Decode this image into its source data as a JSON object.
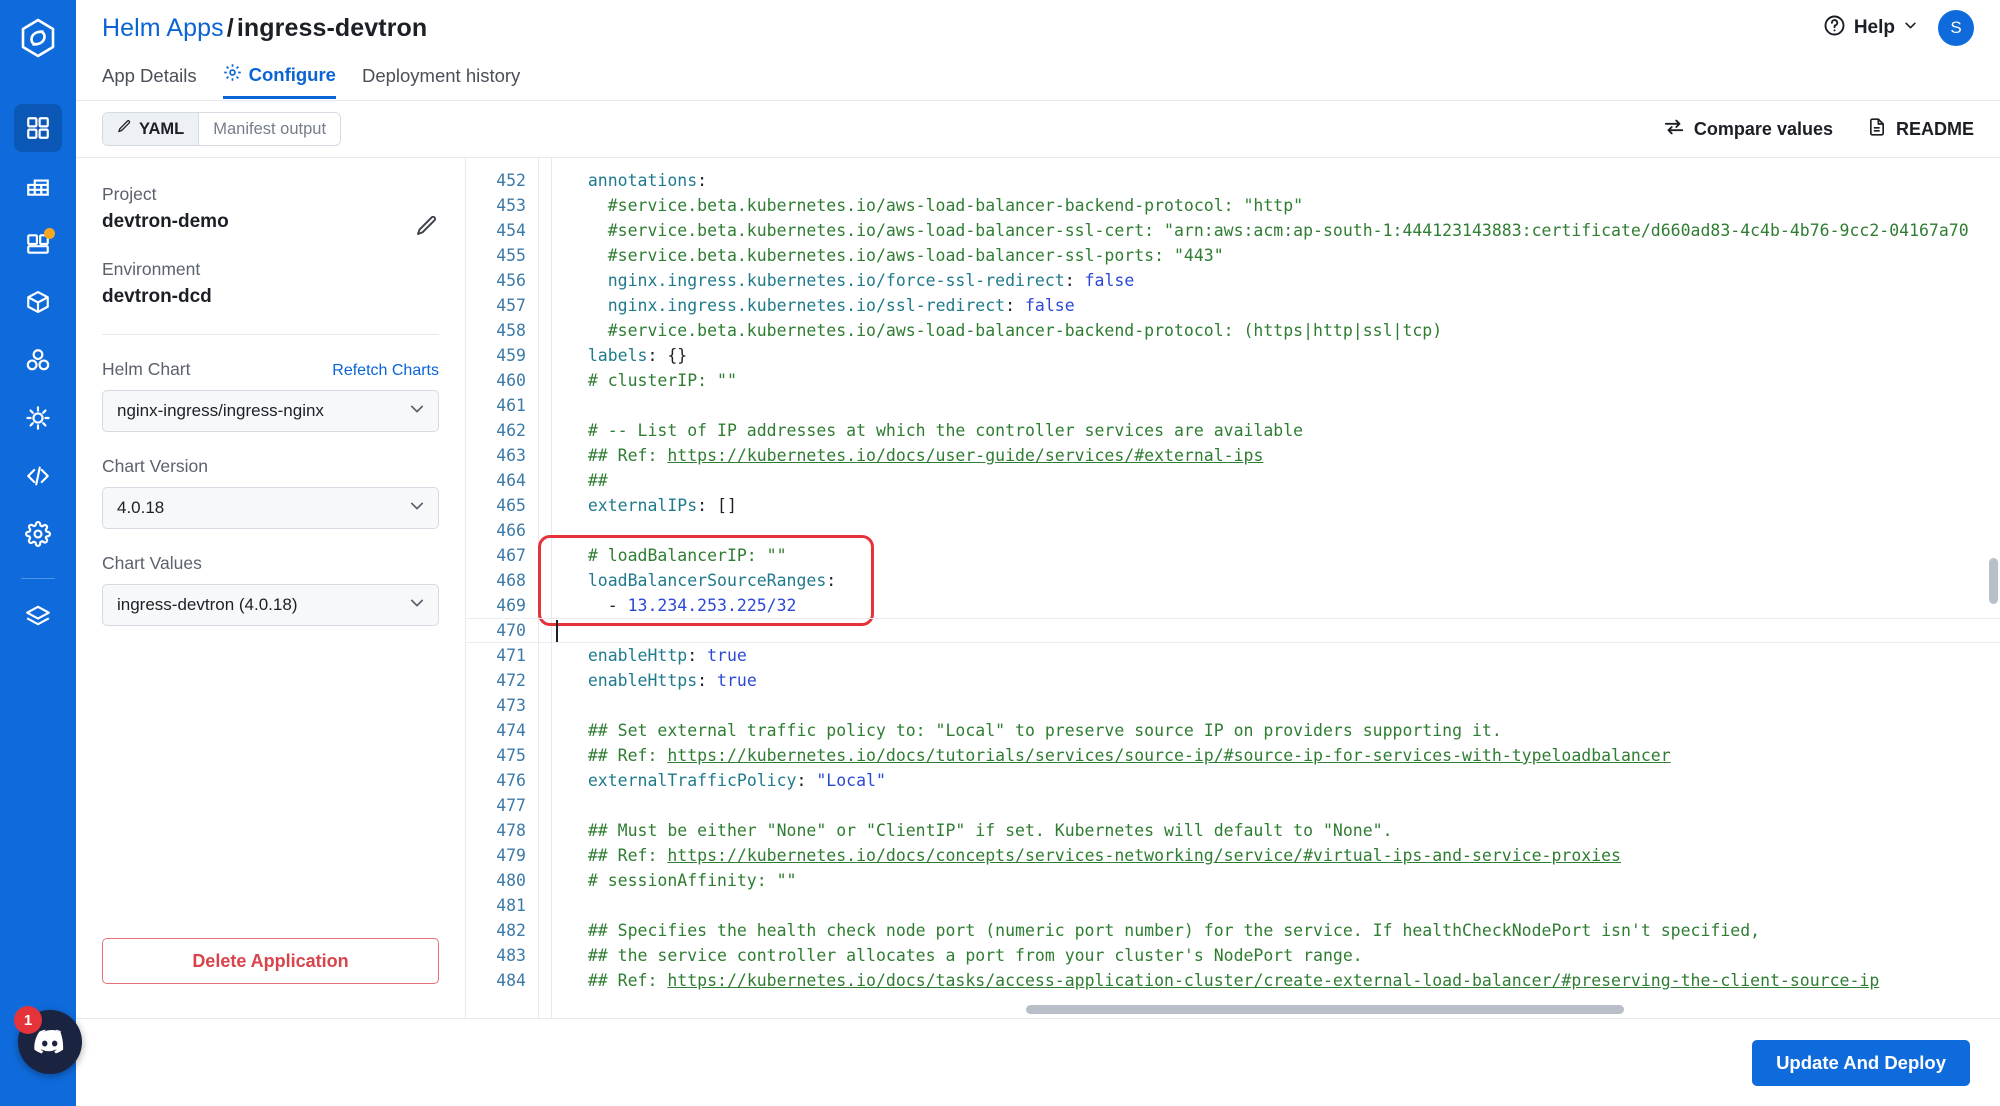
{
  "rail": {
    "logo_icon": "devtron-logo-icon",
    "items": [
      {
        "name": "applications",
        "icon": "grid-icon",
        "active": true,
        "dot": false
      },
      {
        "name": "jobs",
        "icon": "table-icon",
        "active": false,
        "dot": false
      },
      {
        "name": "charts",
        "icon": "blocks-icon",
        "active": false,
        "dot": true
      },
      {
        "name": "resource-browser",
        "icon": "cube-icon",
        "active": false,
        "dot": false
      },
      {
        "name": "clusters",
        "icon": "molecule-icon",
        "active": false,
        "dot": false
      },
      {
        "name": "bulk-edit",
        "icon": "sun-gear-icon",
        "active": false,
        "dot": false
      },
      {
        "name": "code-editor",
        "icon": "code-icon",
        "active": false,
        "dot": false
      },
      {
        "name": "global-config",
        "icon": "gear-icon",
        "active": false,
        "dot": false
      },
      {
        "name": "stack-manager",
        "icon": "layers-icon",
        "active": false,
        "dot": false
      }
    ],
    "discord": {
      "icon": "discord-icon",
      "badge": "1"
    }
  },
  "header": {
    "breadcrumb_parent": "Helm Apps",
    "breadcrumb_sep": "/",
    "breadcrumb_current": "ingress-devtron",
    "help_label": "Help",
    "help_icon": "question-circle-icon",
    "help_chevron_icon": "chevron-down-icon",
    "avatar_initial": "S",
    "tabs": [
      {
        "label": "App Details",
        "active": false,
        "icon": null
      },
      {
        "label": "Configure",
        "active": true,
        "icon": "gear-icon"
      },
      {
        "label": "Deployment history",
        "active": false,
        "icon": null
      }
    ]
  },
  "toolbar": {
    "segments": [
      {
        "label": "YAML",
        "active": true,
        "icon": "pencil-icon"
      },
      {
        "label": "Manifest output",
        "active": false,
        "icon": null
      }
    ],
    "compare_label": "Compare values",
    "compare_icon": "compare-arrows-icon",
    "readme_label": "README",
    "readme_icon": "document-icon"
  },
  "panel": {
    "project_label": "Project",
    "project_value": "devtron-demo",
    "environment_label": "Environment",
    "environment_value": "devtron-dcd",
    "edit_icon": "pencil-icon",
    "helm_chart_label": "Helm Chart",
    "refetch_label": "Refetch Charts",
    "helm_chart_value": "nginx-ingress/ingress-nginx",
    "chart_version_label": "Chart Version",
    "chart_version_value": "4.0.18",
    "chart_values_label": "Chart Values",
    "chart_values_value": "ingress-devtron (4.0.18)",
    "chevron_icon": "chevron-down-icon",
    "delete_label": "Delete Application"
  },
  "editor": {
    "first_line_number": 452,
    "cursor_line_number": 470,
    "highlight_lines": [
      467,
      468,
      469
    ],
    "lines": [
      {
        "n": 452,
        "tokens": [
          {
            "t": "  ",
            "c": "pln"
          },
          {
            "t": "annotations",
            "c": "key"
          },
          {
            "t": ":",
            "c": "pln"
          }
        ]
      },
      {
        "n": 453,
        "tokens": [
          {
            "t": "    #service.beta.kubernetes.io/aws-load-balancer-backend-protocol: \"http\"",
            "c": "com"
          }
        ]
      },
      {
        "n": 454,
        "tokens": [
          {
            "t": "    #service.beta.kubernetes.io/aws-load-balancer-ssl-cert: \"arn:aws:acm:ap-south-1:444123143883:certificate/d660ad83-4c4b-4b76-9cc2-04167a70",
            "c": "com"
          }
        ]
      },
      {
        "n": 455,
        "tokens": [
          {
            "t": "    #service.beta.kubernetes.io/aws-load-balancer-ssl-ports: \"443\"",
            "c": "com"
          }
        ]
      },
      {
        "n": 456,
        "tokens": [
          {
            "t": "    ",
            "c": "pln"
          },
          {
            "t": "nginx.ingress.kubernetes.io/force-ssl-redirect",
            "c": "key"
          },
          {
            "t": ": ",
            "c": "pln"
          },
          {
            "t": "false",
            "c": "val"
          }
        ]
      },
      {
        "n": 457,
        "tokens": [
          {
            "t": "    ",
            "c": "pln"
          },
          {
            "t": "nginx.ingress.kubernetes.io/ssl-redirect",
            "c": "key"
          },
          {
            "t": ": ",
            "c": "pln"
          },
          {
            "t": "false",
            "c": "val"
          }
        ]
      },
      {
        "n": 458,
        "tokens": [
          {
            "t": "    #service.beta.kubernetes.io/aws-load-balancer-backend-protocol: (https|http|ssl|tcp)",
            "c": "com"
          }
        ]
      },
      {
        "n": 459,
        "tokens": [
          {
            "t": "  ",
            "c": "pln"
          },
          {
            "t": "labels",
            "c": "key"
          },
          {
            "t": ": ",
            "c": "pln"
          },
          {
            "t": "{}",
            "c": "pln"
          }
        ]
      },
      {
        "n": 460,
        "tokens": [
          {
            "t": "  # clusterIP: \"\"",
            "c": "com"
          }
        ]
      },
      {
        "n": 461,
        "tokens": [
          {
            "t": "",
            "c": "pln"
          }
        ]
      },
      {
        "n": 462,
        "tokens": [
          {
            "t": "  # -- List of IP addresses at which the controller services are available",
            "c": "com"
          }
        ]
      },
      {
        "n": 463,
        "tokens": [
          {
            "t": "  ## Ref: ",
            "c": "com"
          },
          {
            "t": "https://kubernetes.io/docs/user-guide/services/#external-ips",
            "c": "url"
          }
        ]
      },
      {
        "n": 464,
        "tokens": [
          {
            "t": "  ##",
            "c": "com"
          }
        ]
      },
      {
        "n": 465,
        "tokens": [
          {
            "t": "  ",
            "c": "pln"
          },
          {
            "t": "externalIPs",
            "c": "key"
          },
          {
            "t": ": ",
            "c": "pln"
          },
          {
            "t": "[]",
            "c": "pln"
          }
        ]
      },
      {
        "n": 466,
        "tokens": [
          {
            "t": "",
            "c": "pln"
          }
        ]
      },
      {
        "n": 467,
        "tokens": [
          {
            "t": "  # loadBalancerIP: \"\"",
            "c": "com"
          }
        ]
      },
      {
        "n": 468,
        "tokens": [
          {
            "t": "  ",
            "c": "pln"
          },
          {
            "t": "loadBalancerSourceRanges",
            "c": "key"
          },
          {
            "t": ":",
            "c": "pln"
          }
        ]
      },
      {
        "n": 469,
        "tokens": [
          {
            "t": "    - ",
            "c": "pln"
          },
          {
            "t": "13.234.253.225/32",
            "c": "val"
          }
        ]
      },
      {
        "n": 470,
        "tokens": [
          {
            "t": "",
            "c": "pln"
          }
        ]
      },
      {
        "n": 471,
        "tokens": [
          {
            "t": "  ",
            "c": "pln"
          },
          {
            "t": "enableHttp",
            "c": "key"
          },
          {
            "t": ": ",
            "c": "pln"
          },
          {
            "t": "true",
            "c": "val"
          }
        ]
      },
      {
        "n": 472,
        "tokens": [
          {
            "t": "  ",
            "c": "pln"
          },
          {
            "t": "enableHttps",
            "c": "key"
          },
          {
            "t": ": ",
            "c": "pln"
          },
          {
            "t": "true",
            "c": "val"
          }
        ]
      },
      {
        "n": 473,
        "tokens": [
          {
            "t": "",
            "c": "pln"
          }
        ]
      },
      {
        "n": 474,
        "tokens": [
          {
            "t": "  ## Set external traffic policy to: \"Local\" to preserve source IP on providers supporting it.",
            "c": "com"
          }
        ]
      },
      {
        "n": 475,
        "tokens": [
          {
            "t": "  ## Ref: ",
            "c": "com"
          },
          {
            "t": "https://kubernetes.io/docs/tutorials/services/source-ip/#source-ip-for-services-with-typeloadbalancer",
            "c": "url"
          }
        ]
      },
      {
        "n": 476,
        "tokens": [
          {
            "t": "  ",
            "c": "pln"
          },
          {
            "t": "externalTrafficPolicy",
            "c": "key"
          },
          {
            "t": ": ",
            "c": "pln"
          },
          {
            "t": "\"Local\"",
            "c": "val"
          }
        ]
      },
      {
        "n": 477,
        "tokens": [
          {
            "t": "",
            "c": "pln"
          }
        ]
      },
      {
        "n": 478,
        "tokens": [
          {
            "t": "  ## Must be either \"None\" or \"ClientIP\" if set. Kubernetes will default to \"None\".",
            "c": "com"
          }
        ]
      },
      {
        "n": 479,
        "tokens": [
          {
            "t": "  ## Ref: ",
            "c": "com"
          },
          {
            "t": "https://kubernetes.io/docs/concepts/services-networking/service/#virtual-ips-and-service-proxies",
            "c": "url"
          }
        ]
      },
      {
        "n": 480,
        "tokens": [
          {
            "t": "  # sessionAffinity: \"\"",
            "c": "com"
          }
        ]
      },
      {
        "n": 481,
        "tokens": [
          {
            "t": "",
            "c": "pln"
          }
        ]
      },
      {
        "n": 482,
        "tokens": [
          {
            "t": "  ## Specifies the health check node port (numeric port number) for the service. If healthCheckNodePort isn't specified,",
            "c": "com"
          }
        ]
      },
      {
        "n": 483,
        "tokens": [
          {
            "t": "  ## the service controller allocates a port from your cluster's NodePort range.",
            "c": "com"
          }
        ]
      },
      {
        "n": 484,
        "tokens": [
          {
            "t": "  ## Ref: ",
            "c": "com"
          },
          {
            "t": "https://kubernetes.io/docs/tasks/access-application-cluster/create-external-load-balancer/#preserving-the-client-source-ip",
            "c": "url"
          }
        ]
      }
    ]
  },
  "footer": {
    "deploy_label": "Update And Deploy"
  },
  "colors": {
    "brand_blue": "#0f6bdb",
    "link_blue": "#0a64d6",
    "danger_red": "#d9434c",
    "highlight_red": "#e5333a",
    "comment_green": "#2f7d32",
    "key_teal": "#1f7a8c",
    "value_blue": "#2b49d6",
    "accent_orange": "#f5a623"
  }
}
